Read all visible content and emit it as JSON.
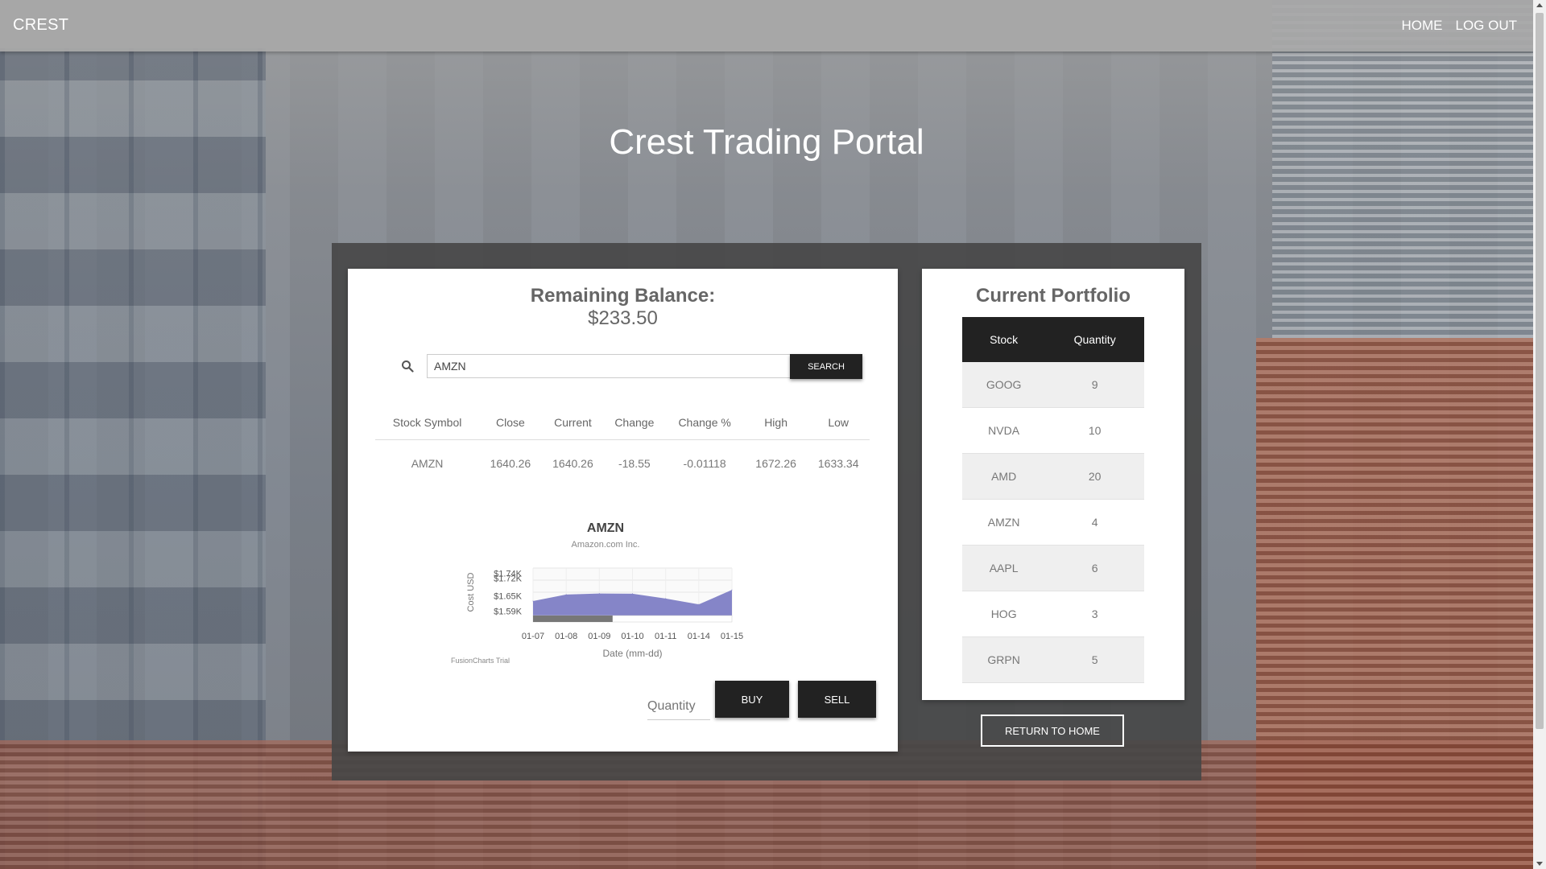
{
  "nav": {
    "brand": "CREST",
    "home": "HOME",
    "logout": "LOG OUT"
  },
  "page": {
    "title": "Crest Trading Portal"
  },
  "balance": {
    "label": "Remaining Balance:",
    "value": "$233.50"
  },
  "search": {
    "value": "AMZN",
    "button": "SEARCH",
    "icon": "search-icon"
  },
  "quote": {
    "headers": [
      "Stock Symbol",
      "Close",
      "Current",
      "Change",
      "Change %",
      "High",
      "Low"
    ],
    "row": [
      "AMZN",
      "1640.26",
      "1640.26",
      "-18.55",
      "-0.01118",
      "1672.26",
      "1633.34"
    ]
  },
  "chart_data": {
    "type": "area",
    "title": "AMZN",
    "subtitle": "Amazon.com Inc.",
    "xlabel": "Date (mm-dd)",
    "ylabel": "Cost USD",
    "x": [
      "01-07",
      "01-08",
      "01-09",
      "01-10",
      "01-11",
      "01-14",
      "01-15"
    ],
    "y_ticks": [
      "$1.74K",
      "$1.72K",
      "$1.65K",
      "$1.59K"
    ],
    "values": [
      1630,
      1656,
      1660,
      1659,
      1640,
      1617,
      1674
    ],
    "ylim": [
      1570,
      1760
    ],
    "colors": {
      "area": "#8585c8",
      "navigator": "#777777"
    },
    "watermark": "FusionCharts Trial"
  },
  "trade": {
    "quantity_placeholder": "Quantity",
    "buy": "BUY",
    "sell": "SELL"
  },
  "portfolio": {
    "title": "Current Portfolio",
    "headers": [
      "Stock",
      "Quantity"
    ],
    "rows": [
      {
        "stock": "GOOG",
        "qty": "9"
      },
      {
        "stock": "NVDA",
        "qty": "10"
      },
      {
        "stock": "AMD",
        "qty": "20"
      },
      {
        "stock": "AMZN",
        "qty": "4"
      },
      {
        "stock": "AAPL",
        "qty": "6"
      },
      {
        "stock": "HOG",
        "qty": "3"
      },
      {
        "stock": "GRPN",
        "qty": "5"
      }
    ]
  },
  "return_button": "RETURN TO HOME"
}
